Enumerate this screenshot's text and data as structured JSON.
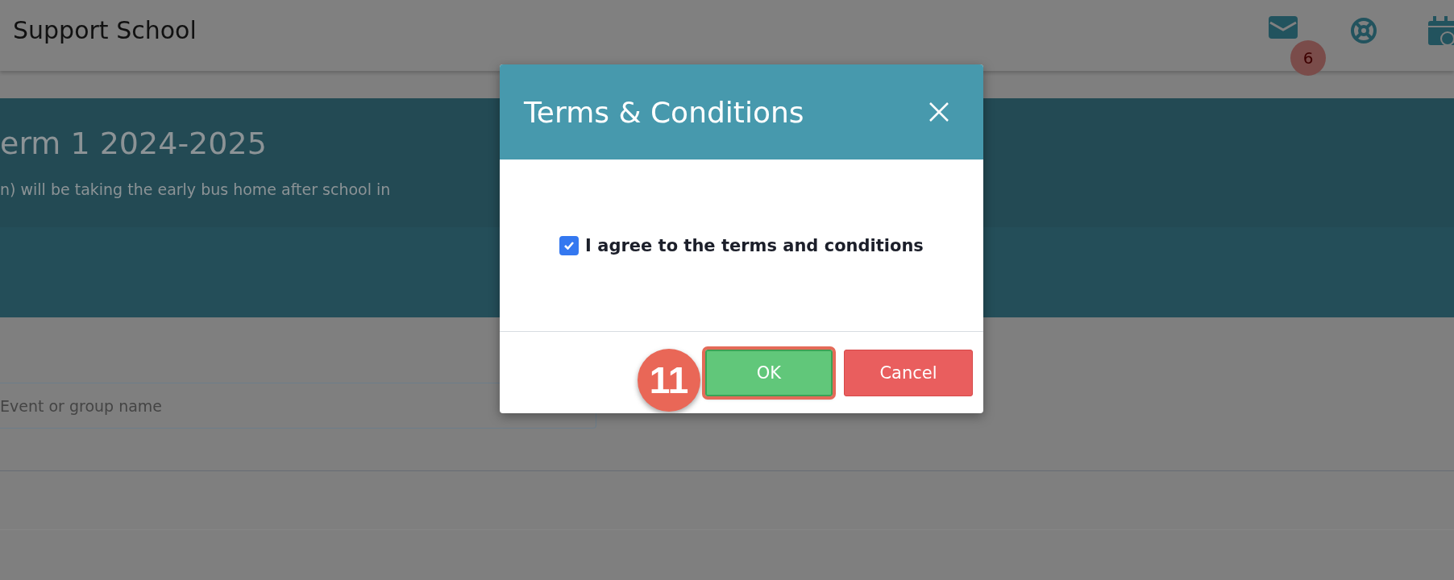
{
  "header": {
    "title": "Support School",
    "messages_badge": "6"
  },
  "banner": {
    "title": "erm 1 2024-2025",
    "text": "n) will be taking the early bus home after school in"
  },
  "search": {
    "placeholder": "Event or group name"
  },
  "dialog": {
    "title": "Terms & Conditions",
    "agreement": {
      "label": "I agree to the terms and conditions",
      "checked": true
    },
    "buttons": [
      {
        "label": "OK",
        "kind": "confirm",
        "highlighted": true
      },
      {
        "label": "Cancel",
        "kind": "cancel",
        "highlighted": false
      }
    ],
    "step_marker": "11"
  }
}
